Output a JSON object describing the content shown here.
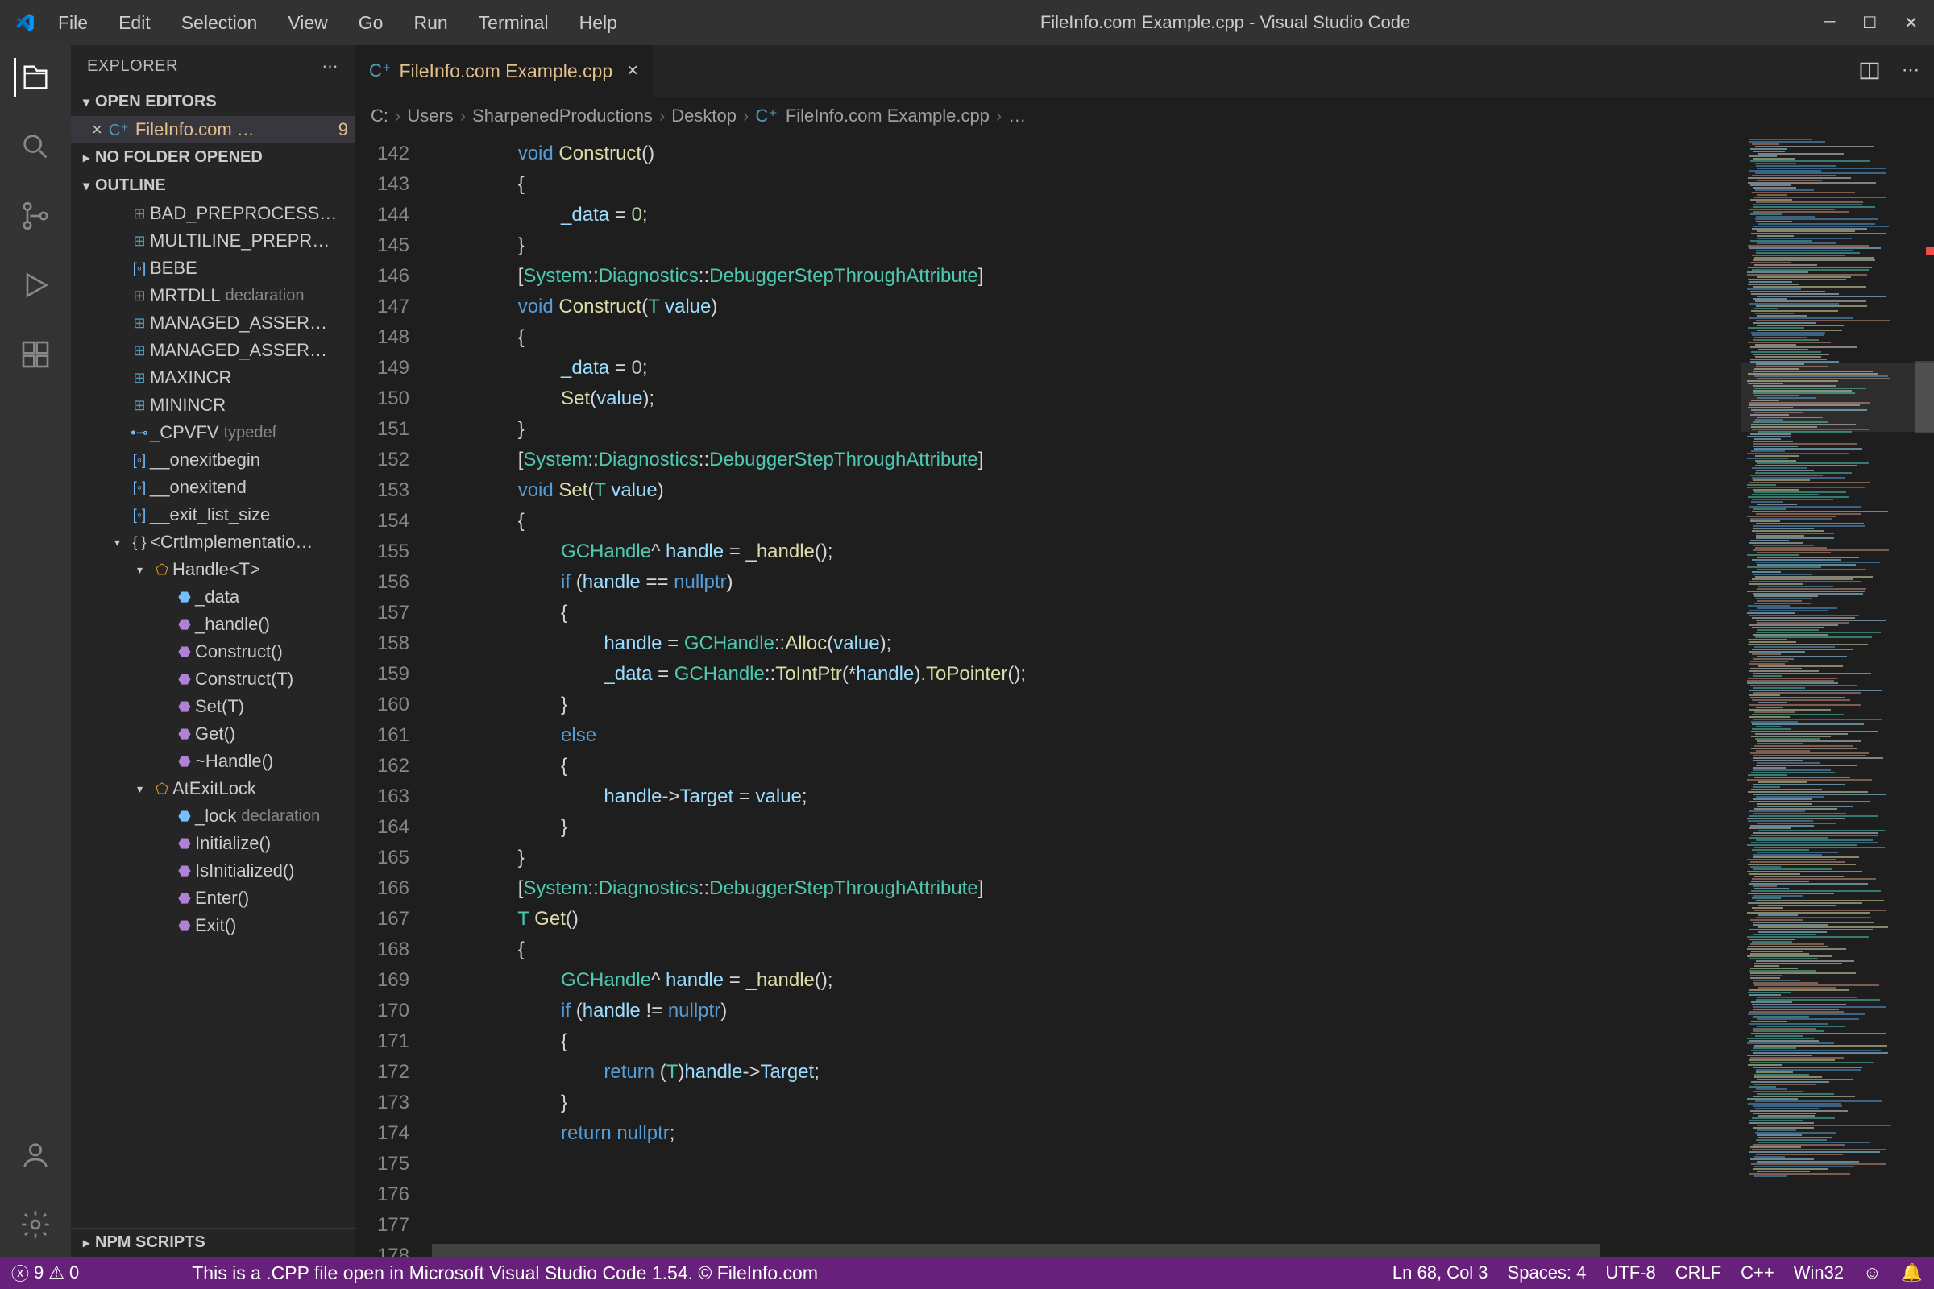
{
  "window": {
    "title": "FileInfo.com Example.cpp - Visual Studio Code"
  },
  "menu": [
    "File",
    "Edit",
    "Selection",
    "View",
    "Go",
    "Run",
    "Terminal",
    "Help"
  ],
  "sidebar": {
    "title": "EXPLORER",
    "open_editors": {
      "label": "OPEN EDITORS",
      "items": [
        {
          "name": "FileInfo.com …",
          "badge": "9"
        }
      ]
    },
    "no_folder": "NO FOLDER OPENED",
    "outline": {
      "label": "OUTLINE",
      "items": [
        {
          "indent": 1,
          "icon": "macro",
          "glyph": "⊞",
          "label": "BAD_PREPROCESS…"
        },
        {
          "indent": 1,
          "icon": "macro",
          "glyph": "⊞",
          "label": "MULTILINE_PREPR…"
        },
        {
          "indent": 1,
          "icon": "var",
          "glyph": "[◦]",
          "label": "BEBE"
        },
        {
          "indent": 1,
          "icon": "macro",
          "glyph": "⊞",
          "label": "MRTDLL",
          "decl": "declaration"
        },
        {
          "indent": 1,
          "icon": "macro",
          "glyph": "⊞",
          "label": "MANAGED_ASSER…"
        },
        {
          "indent": 1,
          "icon": "macro",
          "glyph": "⊞",
          "label": "MANAGED_ASSER…"
        },
        {
          "indent": 1,
          "icon": "macro",
          "glyph": "⊞",
          "label": "MAXINCR"
        },
        {
          "indent": 1,
          "icon": "macro",
          "glyph": "⊞",
          "label": "MININCR"
        },
        {
          "indent": 1,
          "icon": "var",
          "glyph": "•⊸",
          "label": "_CPVFV",
          "decl": "typedef"
        },
        {
          "indent": 1,
          "icon": "var",
          "glyph": "[◦]",
          "label": "__onexitbegin"
        },
        {
          "indent": 1,
          "icon": "var",
          "glyph": "[◦]",
          "label": "__onexitend"
        },
        {
          "indent": 1,
          "icon": "var",
          "glyph": "[◦]",
          "label": "__exit_list_size"
        },
        {
          "indent": 1,
          "icon": "ns",
          "glyph": "{ }",
          "label": "<CrtImplementatio…",
          "chev": "▾"
        },
        {
          "indent": 2,
          "icon": "class",
          "glyph": "⬠",
          "label": "Handle<T>",
          "chev": "▾"
        },
        {
          "indent": 3,
          "icon": "field",
          "glyph": "⬣",
          "label": "_data"
        },
        {
          "indent": 3,
          "icon": "method",
          "glyph": "⬣",
          "label": "_handle()"
        },
        {
          "indent": 3,
          "icon": "method",
          "glyph": "⬣",
          "label": "Construct()"
        },
        {
          "indent": 3,
          "icon": "method",
          "glyph": "⬣",
          "label": "Construct(T)"
        },
        {
          "indent": 3,
          "icon": "method",
          "glyph": "⬣",
          "label": "Set(T)"
        },
        {
          "indent": 3,
          "icon": "method",
          "glyph": "⬣",
          "label": "Get()"
        },
        {
          "indent": 3,
          "icon": "method",
          "glyph": "⬣",
          "label": "~Handle()"
        },
        {
          "indent": 2,
          "icon": "class",
          "glyph": "⬠",
          "label": "AtExitLock",
          "chev": "▾"
        },
        {
          "indent": 3,
          "icon": "field",
          "glyph": "⬣",
          "label": "_lock",
          "decl": "declaration"
        },
        {
          "indent": 3,
          "icon": "method",
          "glyph": "⬣",
          "label": "Initialize()"
        },
        {
          "indent": 3,
          "icon": "method",
          "glyph": "⬣",
          "label": "IsInitialized()"
        },
        {
          "indent": 3,
          "icon": "method",
          "glyph": "⬣",
          "label": "Enter()"
        },
        {
          "indent": 3,
          "icon": "method",
          "glyph": "⬣",
          "label": "Exit()"
        }
      ]
    },
    "npm": "NPM SCRIPTS"
  },
  "tab": {
    "name": "FileInfo.com Example.cpp"
  },
  "breadcrumb": [
    "C:",
    "Users",
    "SharpenedProductions",
    "Desktop",
    "FileInfo.com Example.cpp",
    "…"
  ],
  "gutter_start": 142,
  "gutter_end": 178,
  "code_lines": [
    {
      "indent": 2,
      "html": "<span class='kw'>void</span> <span class='fn'>Construct</span><span class='br'>()</span>"
    },
    {
      "indent": 2,
      "html": "<span class='br'>{</span>"
    },
    {
      "indent": 3,
      "html": "<span class='var'>_data</span> <span class='op'>=</span> <span class='num'>0</span><span class='op'>;</span>"
    },
    {
      "indent": 2,
      "html": "<span class='br'>}</span>"
    },
    {
      "indent": 0,
      "html": ""
    },
    {
      "indent": 2,
      "html": "<span class='br'>[</span><span class='type'>System</span><span class='op'>::</span><span class='type'>Diagnostics</span><span class='op'>::</span><span class='type'>DebuggerStepThroughAttribute</span><span class='br'>]</span>"
    },
    {
      "indent": 2,
      "html": "<span class='kw'>void</span> <span class='fn'>Construct</span><span class='br'>(</span><span class='type'>T</span> <span class='var'>value</span><span class='br'>)</span>"
    },
    {
      "indent": 2,
      "html": "<span class='br'>{</span>"
    },
    {
      "indent": 3,
      "html": "<span class='var'>_data</span> <span class='op'>=</span> <span class='num'>0</span><span class='op'>;</span>"
    },
    {
      "indent": 3,
      "html": "<span class='fn'>Set</span><span class='br'>(</span><span class='var'>value</span><span class='br'>);</span>"
    },
    {
      "indent": 2,
      "html": "<span class='br'>}</span>"
    },
    {
      "indent": 0,
      "html": ""
    },
    {
      "indent": 2,
      "html": "<span class='br'>[</span><span class='type'>System</span><span class='op'>::</span><span class='type'>Diagnostics</span><span class='op'>::</span><span class='type'>DebuggerStepThroughAttribute</span><span class='br'>]</span>"
    },
    {
      "indent": 2,
      "html": "<span class='kw'>void</span> <span class='fn'>Set</span><span class='br'>(</span><span class='type'>T</span> <span class='var'>value</span><span class='br'>)</span>"
    },
    {
      "indent": 2,
      "html": "<span class='br'>{</span>"
    },
    {
      "indent": 3,
      "html": "<span class='type'>GCHandle</span><span class='op'>^</span> <span class='var'>handle</span> <span class='op'>=</span> <span class='fn'>_handle</span><span class='br'>();</span>"
    },
    {
      "indent": 3,
      "html": "<span class='kw'>if</span> <span class='br'>(</span><span class='var'>handle</span> <span class='op'>==</span> <span class='kw'>nullptr</span><span class='br'>)</span>"
    },
    {
      "indent": 3,
      "html": "<span class='br'>{</span>"
    },
    {
      "indent": 4,
      "html": "<span class='var'>handle</span> <span class='op'>=</span> <span class='type'>GCHandle</span><span class='op'>::</span><span class='fn'>Alloc</span><span class='br'>(</span><span class='var'>value</span><span class='br'>);</span>"
    },
    {
      "indent": 4,
      "html": "<span class='var'>_data</span> <span class='op'>=</span> <span class='type'>GCHandle</span><span class='op'>::</span><span class='fn'>ToIntPtr</span><span class='br'>(</span><span class='op'>*</span><span class='var'>handle</span><span class='br'>).</span><span class='fn'>ToPointer</span><span class='br'>();</span>"
    },
    {
      "indent": 3,
      "html": "<span class='br'>}</span>"
    },
    {
      "indent": 3,
      "html": "<span class='kw'>else</span>"
    },
    {
      "indent": 3,
      "html": "<span class='br'>{</span>"
    },
    {
      "indent": 4,
      "html": "<span class='var'>handle</span><span class='op'>-&gt;</span><span class='var'>Target</span> <span class='op'>=</span> <span class='var'>value</span><span class='op'>;</span>"
    },
    {
      "indent": 3,
      "html": "<span class='br'>}</span>"
    },
    {
      "indent": 2,
      "html": "<span class='br'>}</span>"
    },
    {
      "indent": 0,
      "html": ""
    },
    {
      "indent": 2,
      "html": "<span class='br'>[</span><span class='type'>System</span><span class='op'>::</span><span class='type'>Diagnostics</span><span class='op'>::</span><span class='type'>DebuggerStepThroughAttribute</span><span class='br'>]</span>"
    },
    {
      "indent": 2,
      "html": "<span class='type'>T</span> <span class='fn'>Get</span><span class='br'>()</span>"
    },
    {
      "indent": 2,
      "html": "<span class='br'>{</span>"
    },
    {
      "indent": 3,
      "html": "<span class='type'>GCHandle</span><span class='op'>^</span> <span class='var'>handle</span> <span class='op'>=</span> <span class='fn'>_handle</span><span class='br'>();</span>"
    },
    {
      "indent": 3,
      "html": "<span class='kw'>if</span> <span class='br'>(</span><span class='var'>handle</span> <span class='op'>!=</span> <span class='kw'>nullptr</span><span class='br'>)</span>"
    },
    {
      "indent": 3,
      "html": "<span class='br'>{</span>"
    },
    {
      "indent": 4,
      "html": "<span class='kw'>return</span> <span class='br'>(</span><span class='type'>T</span><span class='br'>)</span><span class='var'>handle</span><span class='op'>-&gt;</span><span class='var'>Target</span><span class='op'>;</span>"
    },
    {
      "indent": 3,
      "html": "<span class='br'>}</span>"
    },
    {
      "indent": 3,
      "html": "<span class='kw'>return</span> <span class='kw'>nullptr</span><span class='op'>;</span>"
    }
  ],
  "status": {
    "errors": "9",
    "warnings": "0",
    "message": "This is a .CPP file open in Microsoft Visual Studio Code 1.54. © FileInfo.com",
    "ln_col": "Ln 68, Col 3",
    "spaces": "Spaces: 4",
    "encoding": "UTF-8",
    "eol": "CRLF",
    "lang": "C++",
    "os": "Win32"
  }
}
